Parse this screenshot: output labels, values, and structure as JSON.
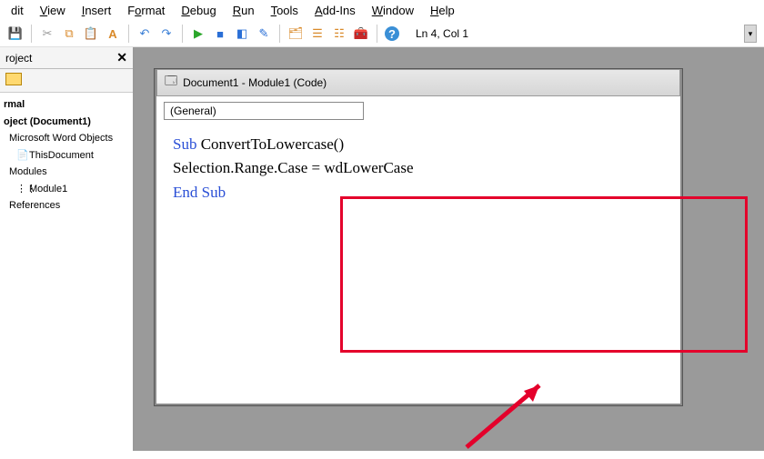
{
  "menu": {
    "items": [
      {
        "pre": "",
        "u": "",
        "post": "dit"
      },
      {
        "pre": "",
        "u": "V",
        "post": "iew"
      },
      {
        "pre": "",
        "u": "I",
        "post": "nsert"
      },
      {
        "pre": "F",
        "u": "o",
        "post": "rmat"
      },
      {
        "pre": "",
        "u": "D",
        "post": "ebug"
      },
      {
        "pre": "",
        "u": "R",
        "post": "un"
      },
      {
        "pre": "",
        "u": "T",
        "post": "ools"
      },
      {
        "pre": "",
        "u": "A",
        "post": "dd-Ins"
      },
      {
        "pre": "",
        "u": "W",
        "post": "indow"
      },
      {
        "pre": "",
        "u": "H",
        "post": "elp"
      }
    ]
  },
  "toolbar": {
    "status": "Ln 4, Col 1",
    "icons": {
      "save": "💾",
      "cut": "✂",
      "copy": "⧉",
      "paste": "📋",
      "find": "A",
      "undo": "↶",
      "redo": "↷",
      "run": "▶",
      "break": "■",
      "reset": "◧",
      "design": "✎",
      "explorer": "🗂",
      "props": "☰",
      "browser": "☷",
      "toolbox": "🧰",
      "help": "?"
    }
  },
  "project_panel": {
    "title": "roject",
    "tree": {
      "normal": "rmal",
      "project": "oject (Document1)",
      "word_objects": "Microsoft Word Objects",
      "this_doc": "ThisDocument",
      "modules": "Modules",
      "module1": "Module1",
      "references": "References"
    }
  },
  "code_window": {
    "title": "Document1 - Module1 (Code)",
    "dropdown": "(General)",
    "code": {
      "l1_kw": "Sub",
      "l1_rest": " ConvertToLowercase()",
      "l2": "Selection.Range.Case = wdLowerCase",
      "l3_kw": "End Sub"
    }
  }
}
